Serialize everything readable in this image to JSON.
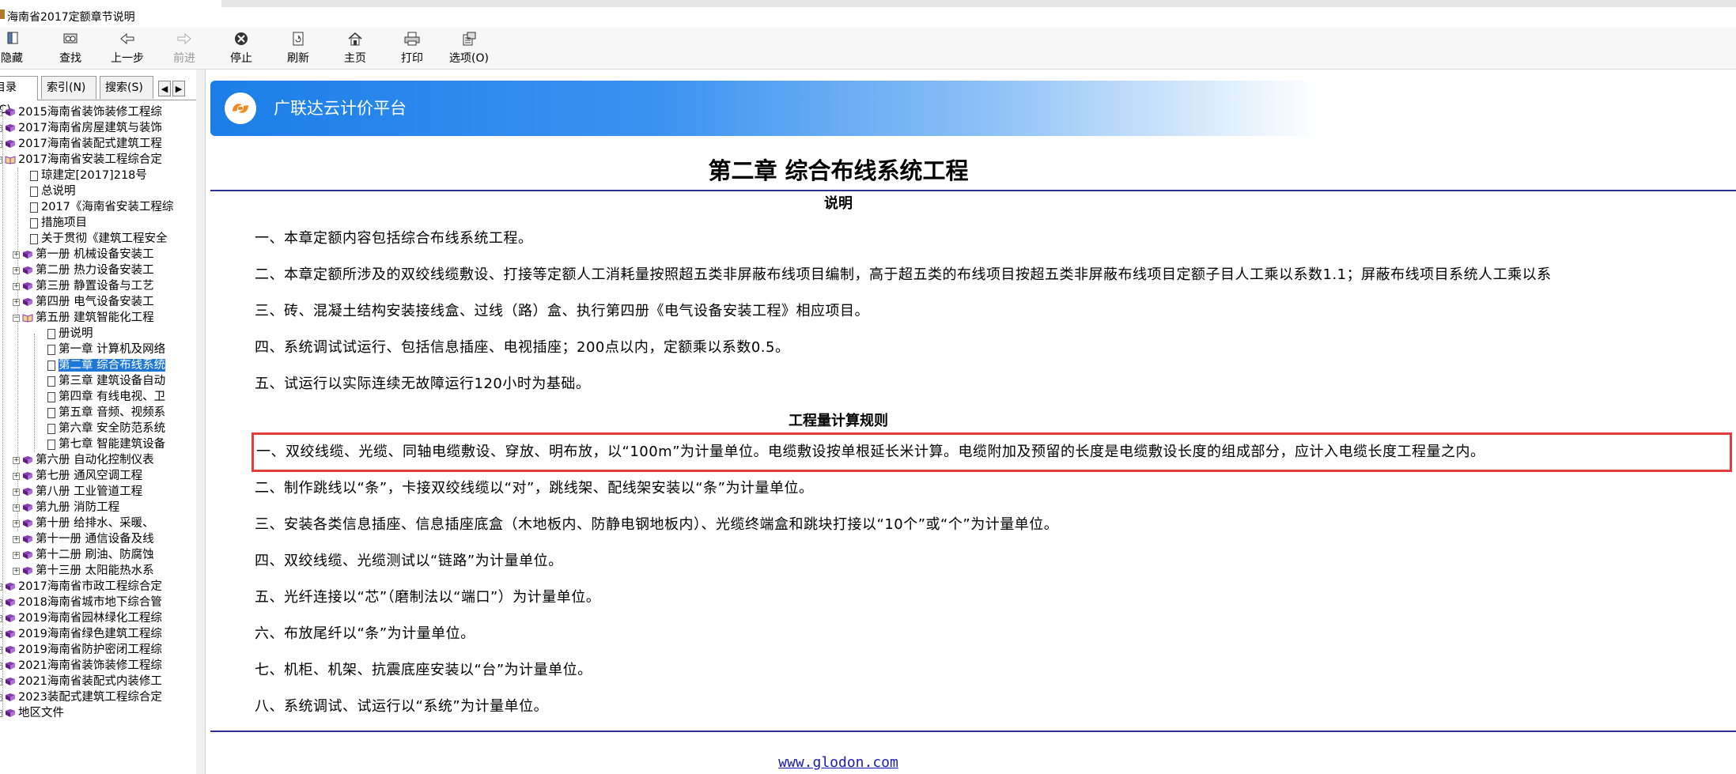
{
  "window": {
    "title": "海南省2017定额章节说明"
  },
  "toolbar": {
    "buttons": [
      {
        "label": "隐藏",
        "icon": "hide-icon"
      },
      {
        "label": "查找",
        "icon": "find-icon"
      },
      {
        "label": "上一步",
        "icon": "back-arrow-icon"
      },
      {
        "label": "前进",
        "icon": "forward-arrow-icon"
      },
      {
        "label": "停止",
        "icon": "stop-icon"
      },
      {
        "label": "刷新",
        "icon": "refresh-icon"
      },
      {
        "label": "主页",
        "icon": "home-icon"
      },
      {
        "label": "打印",
        "icon": "print-icon"
      },
      {
        "label": "选项(O)",
        "icon": "options-icon"
      }
    ]
  },
  "nav": {
    "tabs": [
      "目录(C)",
      "索引(N)",
      "搜索(S)"
    ],
    "tree": [
      {
        "label": "2015海南省装饰装修工程综"
      },
      {
        "label": "2017海南省房屋建筑与装饰"
      },
      {
        "label": "2017海南省装配式建筑工程"
      },
      {
        "label": "2017海南省安装工程综合定"
      },
      {
        "label": "琼建定[2017]218号"
      },
      {
        "label": "总说明"
      },
      {
        "label": "2017《海南省安装工程综"
      },
      {
        "label": "措施项目"
      },
      {
        "label": "关于贯彻《建筑工程安全"
      },
      {
        "label": "第一册 机械设备安装工"
      },
      {
        "label": "第二册 热力设备安装工"
      },
      {
        "label": "第三册 静置设备与工艺"
      },
      {
        "label": "第四册 电气设备安装工"
      },
      {
        "label": "第五册 建筑智能化工程"
      },
      {
        "label": "册说明"
      },
      {
        "label": "第一章 计算机及网络"
      },
      {
        "label": "第二章 综合布线系统"
      },
      {
        "label": "第三章 建筑设备自动"
      },
      {
        "label": "第四章 有线电视、卫"
      },
      {
        "label": "第五章 音频、视频系"
      },
      {
        "label": "第六章 安全防范系统"
      },
      {
        "label": "第七章 智能建筑设备"
      },
      {
        "label": "第六册 自动化控制仪表"
      },
      {
        "label": "第七册 通风空调工程"
      },
      {
        "label": "第八册 工业管道工程"
      },
      {
        "label": "第九册 消防工程"
      },
      {
        "label": "第十册 给排水、采暖、"
      },
      {
        "label": "第十一册 通信设备及线"
      },
      {
        "label": "第十二册 刷油、防腐蚀"
      },
      {
        "label": "第十三册 太阳能热水系"
      },
      {
        "label": "2017海南省市政工程综合定"
      },
      {
        "label": "2018海南省城市地下综合管"
      },
      {
        "label": "2019海南省园林绿化工程综"
      },
      {
        "label": "2019海南省绿色建筑工程综"
      },
      {
        "label": "2019海南省防护密闭工程综"
      },
      {
        "label": "2021海南省装饰装修工程综"
      },
      {
        "label": "2021海南省装配式内装修工"
      },
      {
        "label": "2023装配式建筑工程综合定"
      },
      {
        "label": "地区文件"
      }
    ]
  },
  "content": {
    "banner_text": "广联达云计价平台",
    "chapter_title": "第二章  综合布线系统工程",
    "section1_heading": "说明",
    "section1_items": [
      "一、本章定额内容包括综合布线系统工程。",
      "二、本章定额所涉及的双绞线缆敷设、打接等定额人工消耗量按照超五类非屏蔽布线项目编制，高于超五类的布线项目按超五类非屏蔽布线项目定额子目人工乘以系数1.1；屏蔽布线项目系统人工乘以系",
      "三、砖、混凝土结构安装接线盒、过线（路）盒、执行第四册《电气设备安装工程》相应项目。",
      "四、系统调试试运行、包括信息插座、电视插座；200点以内，定额乘以系数0.5。",
      "五、试运行以实际连续无故障运行120小时为基础。"
    ],
    "section2_heading": "工程量计算规则",
    "section2_items": [
      "一、双绞线缆、光缆、同轴电缆敷设、穿放、明布放，以“100m”为计量单位。电缆敷设按单根延长米计算。电缆附加及预留的长度是电缆敷设长度的组成部分，应计入电缆长度工程量之内。",
      "二、制作跳线以“条”，卡接双绞线缆以“对”，跳线架、配线架安装以“条”为计量单位。",
      "三、安装各类信息插座、信息插座底盒（木地板内、防静电钢地板内）、光缆终端盒和跳块打接以“10个”或“个”为计量单位。",
      "四、双绞线缆、光缆测试以“链路”为计量单位。",
      "五、光纤连接以“芯”（磨制法以“端口”）为计量单位。",
      "六、布放尾纤以“条”为计量单位。",
      "七、机柜、机架、抗震底座安装以“台”为计量单位。",
      "八、系统调试、试运行以“系统”为计量单位。"
    ],
    "footer_link": "www.glodon.com"
  }
}
